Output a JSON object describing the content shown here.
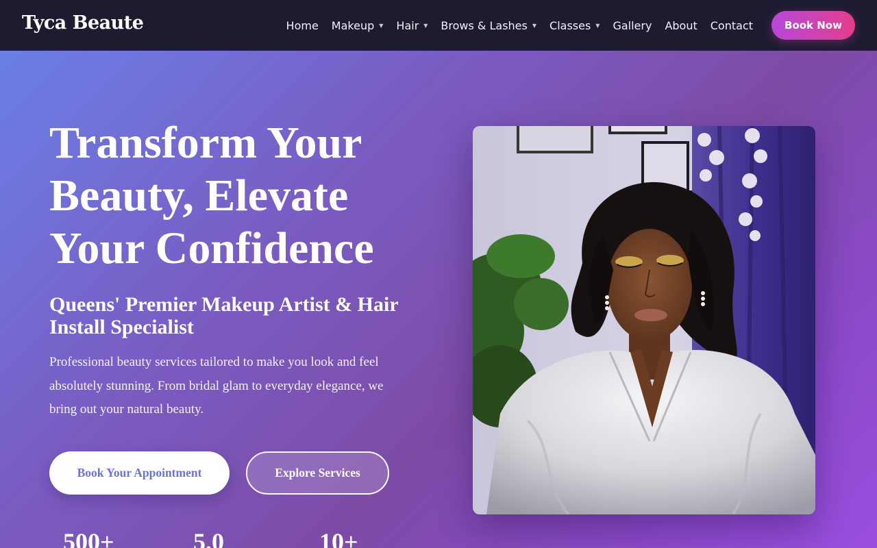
{
  "brand": "Tyca Beaute",
  "nav": {
    "items": [
      {
        "label": "Home",
        "dropdown": false
      },
      {
        "label": "Makeup",
        "dropdown": true
      },
      {
        "label": "Hair",
        "dropdown": true
      },
      {
        "label": "Brows & Lashes",
        "dropdown": true
      },
      {
        "label": "Classes",
        "dropdown": true
      },
      {
        "label": "Gallery",
        "dropdown": false
      },
      {
        "label": "About",
        "dropdown": false
      },
      {
        "label": "Contact",
        "dropdown": false
      }
    ],
    "cta": "Book Now"
  },
  "hero": {
    "title": "Transform Your Beauty, Elevate Your Confidence",
    "subtitle": "Queens' Premier Makeup Artist & Hair Install Specialist",
    "description": "Professional beauty services tailored to make you look and feel absolutely stunning. From bridal glam to everyday elegance, we bring out your natural beauty.",
    "primary_button": "Book Your Appointment",
    "secondary_button": "Explore Services",
    "stats": [
      "500+",
      "5.0",
      "10+"
    ]
  },
  "colors": {
    "nav_bg": "#1d1b30",
    "cta_gradient_start": "#b548d9",
    "cta_gradient_end": "#e33e8b",
    "hero_gradient_start": "#6a7fe6",
    "hero_gradient_end": "#9a4fe0",
    "primary_button_text": "#6b73d8"
  }
}
